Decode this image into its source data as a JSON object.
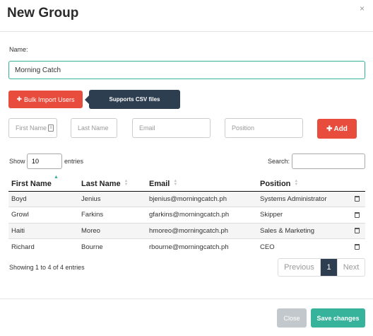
{
  "modal": {
    "title": "New Group",
    "close_glyph": "×"
  },
  "form": {
    "name_label": "Name:",
    "name_value": "Morning Catch",
    "bulk_import_label": "Bulk Import Users",
    "tooltip": "Supports CSV files",
    "first_name_placeholder": "First Name",
    "last_name_placeholder": "Last Name",
    "email_placeholder": "Email",
    "position_placeholder": "Position",
    "add_label": "Add"
  },
  "table_controls": {
    "show_label": "Show",
    "length_value": "10",
    "entries_label": "entries",
    "search_label": "Search:"
  },
  "table": {
    "columns": [
      "First Name",
      "Last Name",
      "Email",
      "Position"
    ],
    "rows": [
      [
        "Boyd",
        "Jenius",
        "bjenius@morningcatch.ph",
        "Systems Administrator"
      ],
      [
        "Growl",
        "Farkins",
        "gfarkins@morningcatch.ph",
        "Skipper"
      ],
      [
        "Haiti",
        "Moreo",
        "hmoreo@morningcatch.ph",
        "Sales & Marketing"
      ],
      [
        "Richard",
        "Bourne",
        "rbourne@morningcatch.ph",
        "CEO"
      ]
    ]
  },
  "pagination": {
    "info": "Showing 1 to 4 of 4 entries",
    "previous": "Previous",
    "current_page": "1",
    "next": "Next"
  },
  "footer": {
    "close_label": "Close",
    "save_label": "Save changes"
  },
  "colors": {
    "accent": "#36b39a",
    "danger": "#e74c3c",
    "dark": "#2c3e50",
    "muted": "#c3c8cc"
  }
}
